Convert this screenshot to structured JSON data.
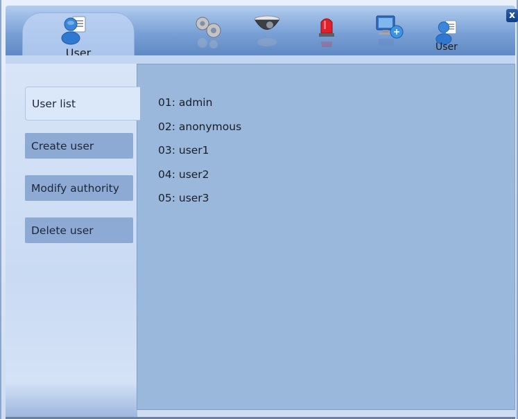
{
  "toolbar": {
    "active_tab_label": "User",
    "user_tab_label": "User",
    "close_label": "x",
    "icons": [
      "user-icon",
      "settings-gears-icon",
      "camera-dome-icon",
      "alarm-siren-icon",
      "network-monitor-icon",
      "user-icon"
    ]
  },
  "sidebar": {
    "items": [
      {
        "label": "User list"
      },
      {
        "label": "Create user"
      },
      {
        "label": "Modify authority"
      },
      {
        "label": "Delete user"
      }
    ]
  },
  "users": [
    "01: admin",
    "02: anonymous",
    "03: user1",
    "04: user2",
    "05: user3"
  ],
  "colors": {
    "panel": "#9ab8dc",
    "sidebar_button": "#8daad4",
    "toolbar": "#7aa1d6"
  }
}
